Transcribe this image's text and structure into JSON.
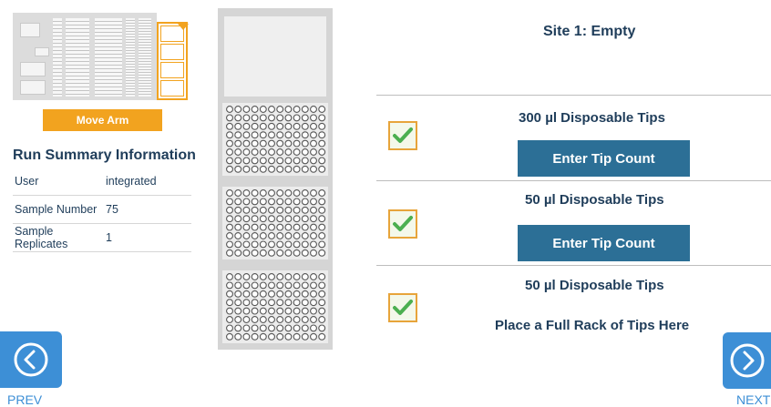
{
  "deck": {
    "move_arm_label": "Move Arm"
  },
  "summary": {
    "title": "Run Summary Information",
    "rows": [
      {
        "key": "User",
        "value": "integrated"
      },
      {
        "key": "Sample Number",
        "value": "75"
      },
      {
        "key": "Sample Replicates",
        "value": "1"
      }
    ]
  },
  "site": {
    "title": "Site 1: Empty"
  },
  "tips": [
    {
      "title": "300 µl Disposable Tips",
      "button_label": "Enter Tip Count",
      "checked": true
    },
    {
      "title": "50 µl Disposable Tips",
      "button_label": "Enter Tip Count",
      "checked": true
    },
    {
      "title": "50 µl Disposable Tips",
      "instruction": "Place a Full Rack of Tips Here",
      "checked": true
    }
  ],
  "nav": {
    "prev_label": "PREV",
    "next_label": "NEXT"
  },
  "colors": {
    "accent_orange": "#f2a31f",
    "nav_blue": "#3d8fd6",
    "button_teal": "#2c6f96",
    "check_green": "#4caf50",
    "text_navy": "#1f3d5a"
  },
  "icons": {
    "prev": "chevron-left-circle-icon",
    "next": "chevron-right-circle-icon",
    "check": "checkmark-icon"
  }
}
